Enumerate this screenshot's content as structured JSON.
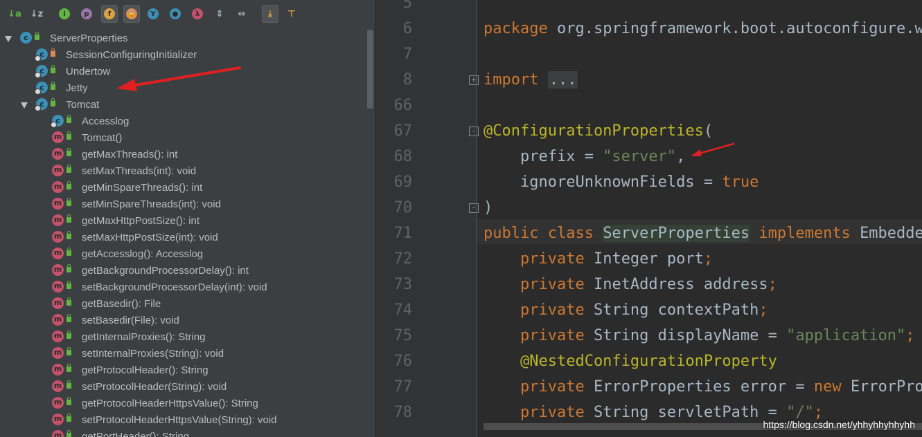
{
  "toolbar": {
    "buttons": [
      {
        "name": "sort-by-type-icon",
        "label": "↓a",
        "color": "#62b543"
      },
      {
        "name": "sort-alphabetically-icon",
        "label": "↓z",
        "color": "#a9b7c6"
      },
      {
        "name": "show-inherited-icon",
        "label": "i",
        "color": "#62b543"
      },
      {
        "name": "show-properties-icon",
        "label": "p",
        "color": "#9876aa"
      },
      {
        "name": "show-fields-icon",
        "label": "f",
        "color": "#d9a343"
      },
      {
        "name": "show-non-public-icon",
        "label": "🔒",
        "color": "#e08855"
      },
      {
        "name": "show-anonymous-icon",
        "label": "Y",
        "color": "#3d8fb5"
      },
      {
        "name": "show-inner-classes-icon",
        "label": "●",
        "color": "#3d8fb5"
      },
      {
        "name": "show-lambdas-icon",
        "label": "λ",
        "color": "#c4526b"
      },
      {
        "name": "expand-all-icon",
        "label": "⇕",
        "color": "#a9b7c6"
      },
      {
        "name": "collapse-all-icon",
        "label": "⇔",
        "color": "#a9b7c6"
      },
      {
        "name": "autoscroll-to-source-icon",
        "label": "⤓",
        "color": "#d9a343"
      },
      {
        "name": "autoscroll-from-source-icon",
        "label": "⊤",
        "color": "#d9a343"
      }
    ]
  },
  "tree": [
    {
      "label": "ServerProperties",
      "kind": "class",
      "depth": 0,
      "arrow": "down",
      "lock": "g"
    },
    {
      "label": "SessionConfiguringInitializer",
      "kind": "class",
      "depth": 1,
      "arrow": "right",
      "lock": "o"
    },
    {
      "label": "Undertow",
      "kind": "class",
      "depth": 1,
      "arrow": "right",
      "lock": "g"
    },
    {
      "label": "Jetty",
      "kind": "class",
      "depth": 1,
      "arrow": "right",
      "lock": "g"
    },
    {
      "label": "Tomcat",
      "kind": "class",
      "depth": 1,
      "arrow": "down",
      "lock": "g"
    },
    {
      "label": "Accesslog",
      "kind": "class",
      "depth": 2,
      "arrow": "right",
      "lock": "g"
    },
    {
      "label": "Tomcat()",
      "kind": "method",
      "depth": 2,
      "lock": "g"
    },
    {
      "label": "getMaxThreads(): int",
      "kind": "method",
      "depth": 2,
      "lock": "g"
    },
    {
      "label": "setMaxThreads(int): void",
      "kind": "method",
      "depth": 2,
      "lock": "g"
    },
    {
      "label": "getMinSpareThreads(): int",
      "kind": "method",
      "depth": 2,
      "lock": "g"
    },
    {
      "label": "setMinSpareThreads(int): void",
      "kind": "method",
      "depth": 2,
      "lock": "g"
    },
    {
      "label": "getMaxHttpPostSize(): int",
      "kind": "method",
      "depth": 2,
      "lock": "g"
    },
    {
      "label": "setMaxHttpPostSize(int): void",
      "kind": "method",
      "depth": 2,
      "lock": "g"
    },
    {
      "label": "getAccesslog(): Accesslog",
      "kind": "method",
      "depth": 2,
      "lock": "g"
    },
    {
      "label": "getBackgroundProcessorDelay(): int",
      "kind": "method",
      "depth": 2,
      "lock": "g"
    },
    {
      "label": "setBackgroundProcessorDelay(int): void",
      "kind": "method",
      "depth": 2,
      "lock": "g"
    },
    {
      "label": "getBasedir(): File",
      "kind": "method",
      "depth": 2,
      "lock": "g"
    },
    {
      "label": "setBasedir(File): void",
      "kind": "method",
      "depth": 2,
      "lock": "g"
    },
    {
      "label": "getInternalProxies(): String",
      "kind": "method",
      "depth": 2,
      "lock": "g"
    },
    {
      "label": "setInternalProxies(String): void",
      "kind": "method",
      "depth": 2,
      "lock": "g"
    },
    {
      "label": "getProtocolHeader(): String",
      "kind": "method",
      "depth": 2,
      "lock": "g"
    },
    {
      "label": "setProtocolHeader(String): void",
      "kind": "method",
      "depth": 2,
      "lock": "g"
    },
    {
      "label": "getProtocolHeaderHttpsValue(): String",
      "kind": "method",
      "depth": 2,
      "lock": "g"
    },
    {
      "label": "setProtocolHeaderHttpsValue(String): void",
      "kind": "method",
      "depth": 2,
      "lock": "g"
    },
    {
      "label": "getPortHeader(): String",
      "kind": "method",
      "depth": 2,
      "lock": "g"
    }
  ],
  "editor": {
    "lines": [
      {
        "num": "5",
        "parts": []
      },
      {
        "num": "6",
        "parts": [
          [
            "kw",
            "package "
          ],
          [
            "",
            "org.springframework.boot.autoconfigure.we"
          ]
        ]
      },
      {
        "num": "7",
        "parts": []
      },
      {
        "num": "8",
        "parts": [
          [
            "kw",
            "import "
          ],
          [
            "fold",
            "..."
          ]
        ],
        "fold": "+"
      },
      {
        "num": "66",
        "parts": []
      },
      {
        "num": "67",
        "parts": [
          [
            "ann",
            "@ConfigurationProperties"
          ],
          [
            "",
            "("
          ]
        ],
        "fold": "-"
      },
      {
        "num": "68",
        "parts": [
          [
            "",
            "    prefix = "
          ],
          [
            "str",
            "\"server\""
          ],
          [
            "",
            ","
          ]
        ]
      },
      {
        "num": "69",
        "parts": [
          [
            "",
            "    ignoreUnknownFields = "
          ],
          [
            "kw",
            "true"
          ]
        ]
      },
      {
        "num": "70",
        "parts": [
          [
            "",
            ")"
          ]
        ],
        "fold": "-"
      },
      {
        "num": "71",
        "parts": [
          [
            "kw",
            "public class "
          ],
          [
            "hl",
            "ServerProperties"
          ],
          [
            "kw",
            " implements "
          ],
          [
            "",
            "Embedded"
          ]
        ]
      },
      {
        "num": "72",
        "parts": [
          [
            "kw",
            "    private "
          ],
          [
            "",
            "Integer port"
          ],
          [
            "kw",
            ";"
          ]
        ]
      },
      {
        "num": "73",
        "parts": [
          [
            "kw",
            "    private "
          ],
          [
            "",
            "InetAddress address"
          ],
          [
            "kw",
            ";"
          ]
        ]
      },
      {
        "num": "74",
        "parts": [
          [
            "kw",
            "    private "
          ],
          [
            "",
            "String contextPath"
          ],
          [
            "kw",
            ";"
          ]
        ]
      },
      {
        "num": "75",
        "parts": [
          [
            "kw",
            "    private "
          ],
          [
            "",
            "String displayName = "
          ],
          [
            "str",
            "\"application\""
          ],
          [
            "kw",
            ";"
          ]
        ]
      },
      {
        "num": "76",
        "parts": [
          [
            "ann",
            "    @NestedConfigurationProperty"
          ]
        ]
      },
      {
        "num": "77",
        "parts": [
          [
            "kw",
            "    private "
          ],
          [
            "",
            "ErrorProperties error = "
          ],
          [
            "kw",
            "new "
          ],
          [
            "",
            "ErrorProp"
          ]
        ]
      },
      {
        "num": "78",
        "parts": [
          [
            "kw",
            "    private "
          ],
          [
            "",
            "String servletPath = "
          ],
          [
            "str",
            "\"/\""
          ],
          [
            "kw",
            ";"
          ]
        ]
      }
    ]
  },
  "watermark": "https://blog.csdn.net/yhhyhhyhhyhh"
}
